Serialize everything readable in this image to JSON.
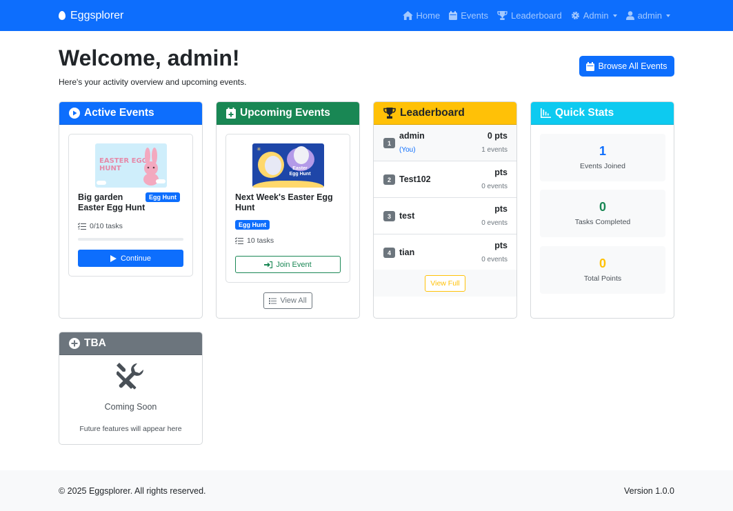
{
  "nav": {
    "brand": "Eggsplorer",
    "home": "Home",
    "events": "Events",
    "leaderboard": "Leaderboard",
    "admin_menu": "Admin",
    "user_menu": "admin"
  },
  "header": {
    "welcome": "Welcome, admin!",
    "subtext": "Here's your activity overview and upcoming events.",
    "browse_button": "Browse All Events"
  },
  "active_events": {
    "title": "Active Events",
    "event": {
      "image_text": "EASTER EGG HUNT",
      "name": "Big garden Easter Egg Hunt",
      "badge": "Egg Hunt",
      "tasks": "0/10 tasks",
      "progress": 0,
      "button": "Continue"
    }
  },
  "upcoming_events": {
    "title": "Upcoming Events",
    "event": {
      "image_text": "Easter Egg Hunt",
      "name": "Next Week's Easter Egg Hunt",
      "badge": "Egg Hunt",
      "tasks": "10 tasks",
      "button": "Join Event"
    },
    "view_all": "View All"
  },
  "leaderboard": {
    "title": "Leaderboard",
    "rows": [
      {
        "rank": "1",
        "name": "admin",
        "you": "(You)",
        "pts": "0 pts",
        "events": "1 events"
      },
      {
        "rank": "2",
        "name": "Test102",
        "pts": "pts",
        "events": "0 events"
      },
      {
        "rank": "3",
        "name": "test",
        "pts": "pts",
        "events": "0 events"
      },
      {
        "rank": "4",
        "name": "tian",
        "pts": "pts",
        "events": "0 events"
      }
    ],
    "view_full": "View Full"
  },
  "quick_stats": {
    "title": "Quick Stats",
    "stats": [
      {
        "value": "1",
        "label": "Events Joined",
        "color": "#0d6efd"
      },
      {
        "value": "0",
        "label": "Tasks Completed",
        "color": "#198754"
      },
      {
        "value": "0",
        "label": "Total Points",
        "color": "#ffc107"
      }
    ]
  },
  "tba": {
    "title": "TBA",
    "heading": "Coming Soon",
    "subtext": "Future features will appear here"
  },
  "footer": {
    "copyright": "© 2025 Eggsplorer. All rights reserved.",
    "version": "Version 1.0.0"
  },
  "colors": {
    "primary": "#0d6efd",
    "success": "#198754",
    "warning": "#ffc107",
    "info": "#0dcaf0",
    "secondary": "#6c757d"
  }
}
